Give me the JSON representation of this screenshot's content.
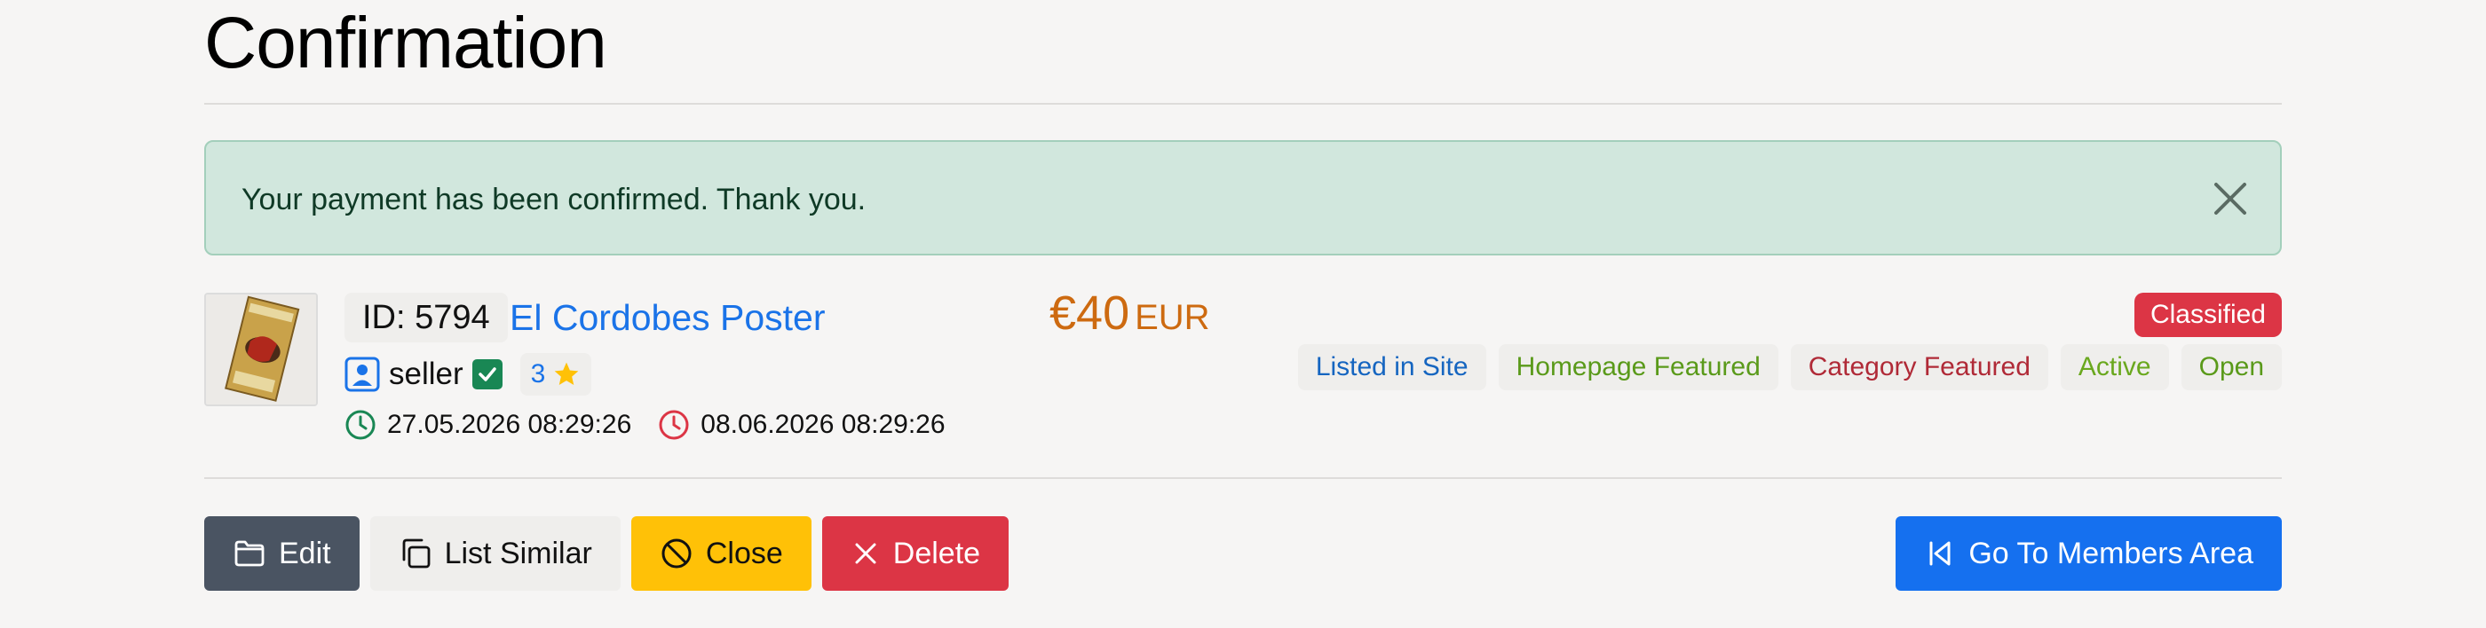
{
  "page": {
    "title": "Confirmation"
  },
  "alert": {
    "message": "Your payment has been confirmed. Thank you.",
    "close_icon": "close-icon",
    "bg": "#d1e7dd"
  },
  "listing": {
    "id_label": "ID: 5794",
    "title": "El Cordobes Poster",
    "seller": {
      "name": "seller",
      "verified": true,
      "rating": "3"
    },
    "dates": {
      "start": "27.05.2026 08:29:26",
      "end": "08.06.2026 08:29:26"
    },
    "price": {
      "amount": "€40",
      "currency": "EUR"
    },
    "type_badge": "Classified",
    "status_tags": [
      {
        "label": "Listed in Site",
        "color": "#1565c0"
      },
      {
        "label": "Homepage Featured",
        "color": "#5a9a1a"
      },
      {
        "label": "Category Featured",
        "color": "#b02a37"
      },
      {
        "label": "Active",
        "color": "#6aa81e"
      },
      {
        "label": "Open",
        "color": "#5a9a1a"
      }
    ]
  },
  "actions": {
    "edit": "Edit",
    "list_similar": "List Similar",
    "close": "Close",
    "delete": "Delete",
    "members_area": "Go To Members Area"
  },
  "colors": {
    "accent": "#1570ef",
    "danger": "#dc3545",
    "warning": "#ffc107",
    "success": "#198754",
    "price": "#cd6a10"
  }
}
